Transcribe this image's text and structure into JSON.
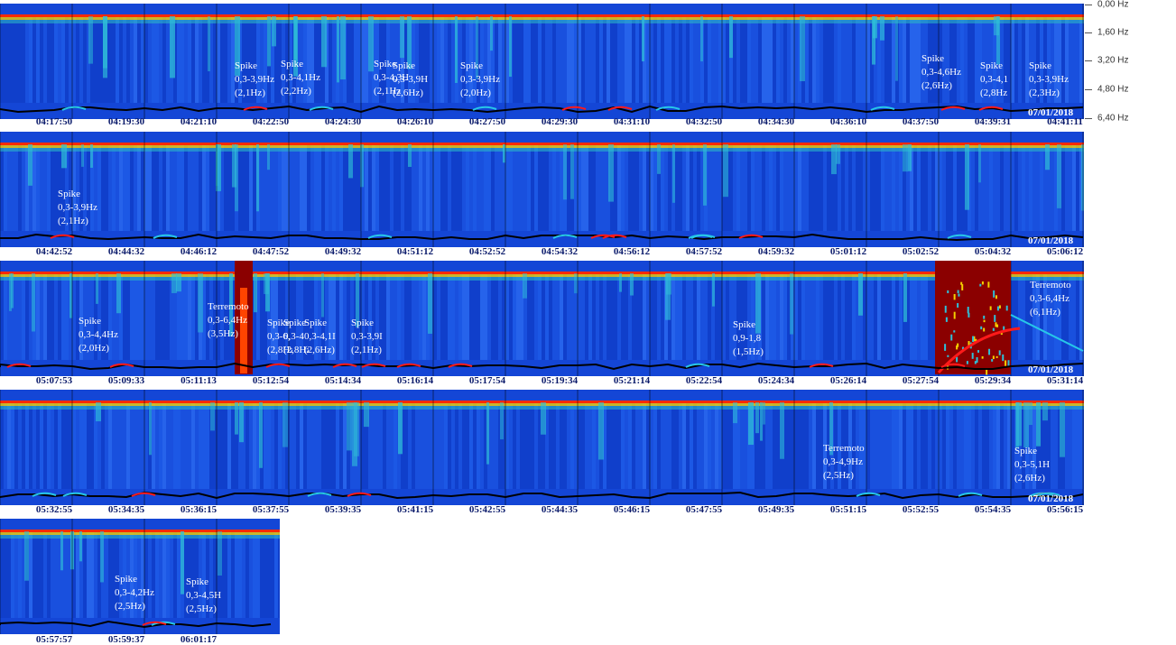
{
  "date": "07/01/2018",
  "freq_axis": {
    "labels": [
      "0,00 Hz",
      "1,60 Hz",
      "3,20 Hz",
      "4,80 Hz",
      "6,40 Hz"
    ],
    "values": [
      0.0,
      1.6,
      3.2,
      4.8,
      6.4
    ]
  },
  "colors": {
    "background": "#1446d6",
    "noise_dark": "#0a2fb0",
    "band_top": "#ff2a00",
    "band_second": "#f4d000",
    "event_red": "#ff1a1a",
    "event_cyan": "#27c8e8",
    "baseline": "#000000",
    "earthquake": "#8b0000"
  },
  "chart_data": {
    "type": "heatmap",
    "title": "",
    "xlabel": "",
    "ylabel": "",
    "ylim": [
      0,
      6.4
    ],
    "y_unit": "Hz",
    "rows": [
      {
        "ticks": [
          "04:17:50",
          "04:19:30",
          "04:21:10",
          "04:22:50",
          "04:24:30",
          "04:26:10",
          "04:27:50",
          "04:29:30",
          "04:31:10",
          "04:32:50",
          "04:34:30",
          "04:36:10",
          "04:37:50",
          "04:39:31",
          "04:41:11"
        ],
        "events": [
          {
            "lines": [
              "Spike",
              "0,3-3,9Hz",
              "(2,1Hz)"
            ]
          },
          {
            "lines": [
              "Spike",
              "0,3-4,1Hz",
              "(2,2Hz)"
            ]
          },
          {
            "lines": [
              "Spike",
              "0,3-4,3H",
              "(2,1Hz"
            ]
          },
          {
            "lines": [
              "Spike",
              "0,3-3,9H",
              "(2,6Hz)"
            ]
          },
          {
            "lines": [
              "Spike",
              "0,3-3,9Hz",
              "(2,0Hz)"
            ]
          },
          {
            "lines": [
              "Spike",
              "0,3-4,6Hz",
              "(2,6Hz)"
            ]
          },
          {
            "lines": [
              "Spike",
              "0,3-4,1",
              "(2,8Hz"
            ]
          },
          {
            "lines": [
              "Spike",
              "0,3-3,9Hz",
              "(2,3Hz)"
            ]
          }
        ]
      },
      {
        "ticks": [
          "04:42:52",
          "04:44:32",
          "04:46:12",
          "04:47:52",
          "04:49:32",
          "04:51:12",
          "04:52:52",
          "04:54:32",
          "04:56:12",
          "04:57:52",
          "04:59:32",
          "05:01:12",
          "05:02:52",
          "05:04:32",
          "05:06:12"
        ],
        "events": [
          {
            "lines": [
              "Spike",
              "0,3-3,9Hz",
              "(2,1Hz)"
            ]
          }
        ]
      },
      {
        "ticks": [
          "05:07:53",
          "05:09:33",
          "05:11:13",
          "05:12:54",
          "05:14:34",
          "05:16:14",
          "05:17:54",
          "05:19:34",
          "05:21:14",
          "05:22:54",
          "05:24:34",
          "05:26:14",
          "05:27:54",
          "05:29:34",
          "05:31:14"
        ],
        "events": [
          {
            "lines": [
              "Spike",
              "0,3-4,4Hz",
              "(2,0Hz)"
            ]
          },
          {
            "lines": [
              "Terremoto",
              "0,3-6,4Hz",
              "(3,5Hz)"
            ]
          },
          {
            "lines": [
              "Spike",
              "0,3-6,",
              "(2,8Hz"
            ]
          },
          {
            "lines": [
              "Spike",
              "0,3-4",
              "(2,8Hz)"
            ]
          },
          {
            "lines": [
              "Spike",
              "0,3-4,1I",
              "(2,6Hz)"
            ]
          },
          {
            "lines": [
              "Spike",
              "0,3-3,9I",
              "(2,1Hz)"
            ]
          },
          {
            "lines": [
              "Spike",
              "0,9-1,8",
              "(1,5Hz)"
            ]
          },
          {
            "lines": [
              "Terremoto",
              "0,3-6,4Hz",
              "(6,1Hz)"
            ]
          }
        ]
      },
      {
        "ticks": [
          "05:32:55",
          "05:34:35",
          "05:36:15",
          "05:37:55",
          "05:39:35",
          "05:41:15",
          "05:42:55",
          "05:44:35",
          "05:46:15",
          "05:47:55",
          "05:49:35",
          "05:51:15",
          "05:52:55",
          "05:54:35",
          "05:56:15"
        ],
        "events": [
          {
            "lines": [
              "Terremoto",
              "0,3-4,9Hz",
              "(2,5Hz)"
            ]
          },
          {
            "lines": [
              "Spike",
              "0,3-5,1H",
              "(2,6Hz)"
            ]
          }
        ]
      },
      {
        "ticks": [
          "05:57:57",
          "05:59:37",
          "06:01:17"
        ],
        "events": [
          {
            "lines": [
              "Spike",
              "0,3-4,2Hz",
              "(2,5Hz)"
            ]
          },
          {
            "lines": [
              "Spike",
              "0,3-4,5H",
              "(2,5Hz)"
            ]
          }
        ]
      }
    ]
  }
}
